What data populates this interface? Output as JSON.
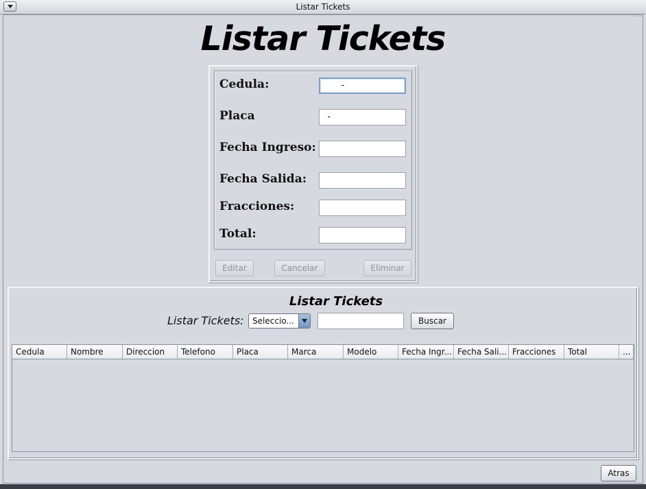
{
  "window": {
    "title": "Listar Tickets"
  },
  "heading": "Listar Tickets",
  "form": {
    "fields": [
      {
        "label": "Cedula:",
        "value": "       -"
      },
      {
        "label": "Placa",
        "value": "  -"
      },
      {
        "label": "Fecha Ingreso:",
        "value": ""
      },
      {
        "label": "Fecha Salida:",
        "value": ""
      },
      {
        "label": "Fracciones:",
        "value": ""
      },
      {
        "label": "Total:",
        "value": ""
      }
    ],
    "buttons": {
      "edit": "Editar",
      "cancel": "Cancelar",
      "delete": "Eliminar"
    }
  },
  "panel": {
    "title": "Listar Tickets",
    "search_label": "Listar Tickets:",
    "combo_value": "Seleccio...",
    "search_value": "",
    "search_button": "Buscar"
  },
  "table": {
    "columns": [
      "Cedula",
      "Nombre",
      "Direccion",
      "Telefono",
      "Placa",
      "Marca",
      "Modelo",
      "Fecha Ingr...",
      "Fecha Sali...",
      "Fracciones",
      "Total",
      "..."
    ],
    "rows": []
  },
  "footer": {
    "back_button": "Atras"
  }
}
